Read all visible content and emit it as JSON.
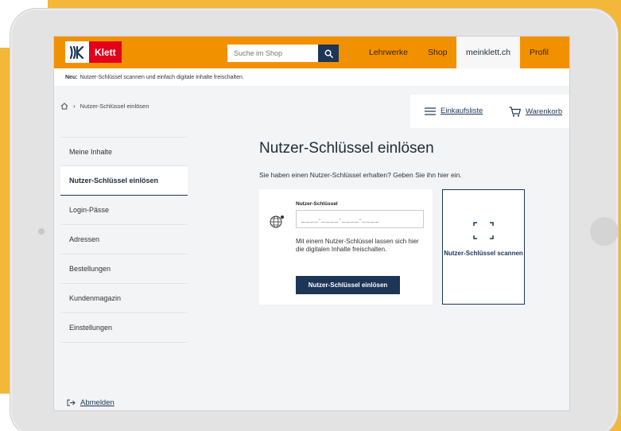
{
  "colors": {
    "brand_orange": "#f29100",
    "klett_red": "#e2001a",
    "navy": "#1d3557",
    "background_yellow": "#f3b73a"
  },
  "header": {
    "logo_text": "Klett",
    "search_placeholder": "Suche im Shop",
    "nav": {
      "lehrwerke": "Lehrwerke",
      "shop": "Shop",
      "meinklett": "meinklett.ch",
      "profil": "Profil"
    }
  },
  "notice": {
    "label": "Neu:",
    "text": "Nutzer-Schlüssel scannen und einfach digitale Inhalte freischalten."
  },
  "breadcrumb": {
    "home_icon": "home-icon",
    "separator": "›",
    "current": "Nutzer-Schlüssel einlösen"
  },
  "tools": {
    "list_label": "Einkaufsliste",
    "cart_label": "Warenkorb"
  },
  "sidebar": {
    "items": [
      {
        "label": "Meine Inhalte"
      },
      {
        "label": "Nutzer-Schlüssel einlösen"
      },
      {
        "label": "Login-Pässe"
      },
      {
        "label": "Adressen"
      },
      {
        "label": "Bestellungen"
      },
      {
        "label": "Kundenmagazin"
      },
      {
        "label": "Einstellungen"
      }
    ],
    "logout_label": "Abmelden"
  },
  "main": {
    "title": "Nutzer-Schlüssel einlösen",
    "subtitle": "Sie haben einen Nutzer-Schlüssel erhalten? Geben Sie ihn hier ein.",
    "field_label": "Nutzer-Schlüssel",
    "field_placeholder": "____-____-____-____",
    "hint": "Mit einem Nutzer-Schlüssel lassen sich hier die digitalen Inhalte freischalten.",
    "submit_label": "Nutzer-Schlüssel einlösen",
    "scan_label": "Nutzer-Schlüssel scannen"
  }
}
